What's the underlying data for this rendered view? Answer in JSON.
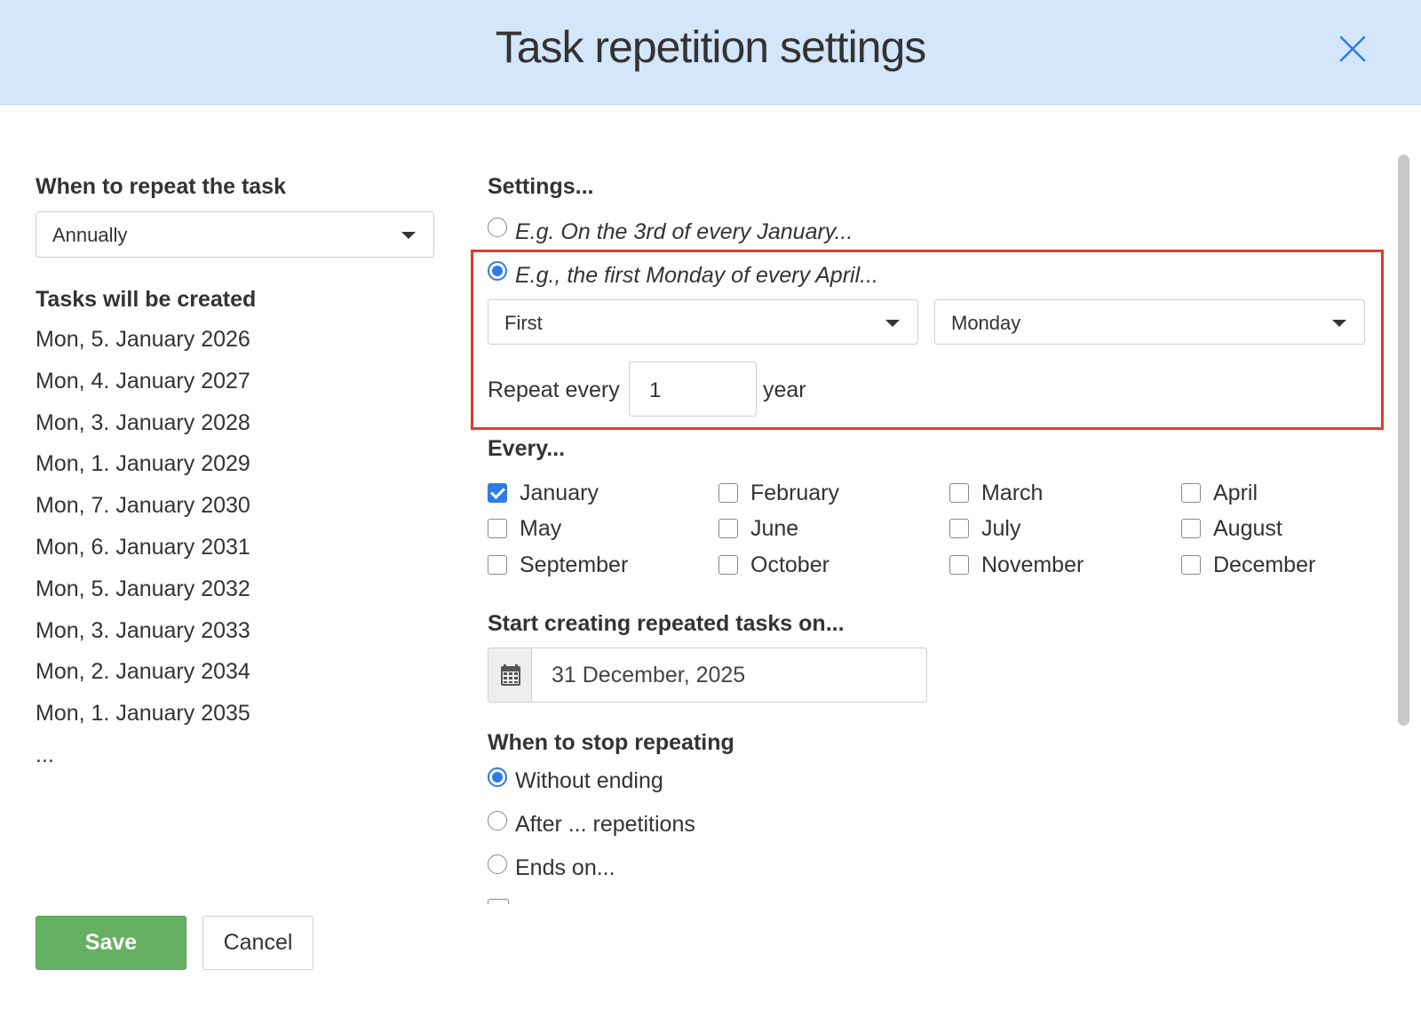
{
  "dialog": {
    "title": "Task repetition settings"
  },
  "left": {
    "when_label": "When to repeat the task",
    "frequency_value": "Annually",
    "tasks_label": "Tasks will be created",
    "tasks": [
      "Mon, 5. January 2026",
      "Mon, 4. January 2027",
      "Mon, 3. January 2028",
      "Mon, 1. January 2029",
      "Mon, 7. January 2030",
      "Mon, 6. January 2031",
      "Mon, 5. January 2032",
      "Mon, 3. January 2033",
      "Mon, 2. January 2034",
      "Mon, 1. January 2035"
    ],
    "ellipsis": "..."
  },
  "settings": {
    "label": "Settings...",
    "option1": "E.g. On the 3rd of every January...",
    "option2": "E.g., the first Monday of every April...",
    "selected_option": 2,
    "ordinal_value": "First",
    "weekday_value": "Monday",
    "repeat_every_label": "Repeat every",
    "repeat_every_value": "1",
    "repeat_unit": "year"
  },
  "every": {
    "label": "Every...",
    "months": [
      {
        "name": "January",
        "checked": true
      },
      {
        "name": "February",
        "checked": false
      },
      {
        "name": "March",
        "checked": false
      },
      {
        "name": "April",
        "checked": false
      },
      {
        "name": "May",
        "checked": false
      },
      {
        "name": "June",
        "checked": false
      },
      {
        "name": "July",
        "checked": false
      },
      {
        "name": "August",
        "checked": false
      },
      {
        "name": "September",
        "checked": false
      },
      {
        "name": "October",
        "checked": false
      },
      {
        "name": "November",
        "checked": false
      },
      {
        "name": "December",
        "checked": false
      }
    ]
  },
  "start": {
    "label": "Start creating repeated tasks on...",
    "date_value": "31 December, 2025"
  },
  "stop": {
    "label": "When to stop repeating",
    "options": [
      "Without ending",
      "After ... repetitions",
      "Ends on..."
    ],
    "selected": 0
  },
  "footer": {
    "save_label": "Save",
    "cancel_label": "Cancel"
  },
  "colors": {
    "header_bg": "#d4e6f9",
    "accent": "#2c7be5",
    "highlight": "#e03c2c",
    "save_bg": "#65b062"
  },
  "icons": [
    "close-icon",
    "chevron-down-icon",
    "calendar-icon",
    "checkmark-icon"
  ]
}
